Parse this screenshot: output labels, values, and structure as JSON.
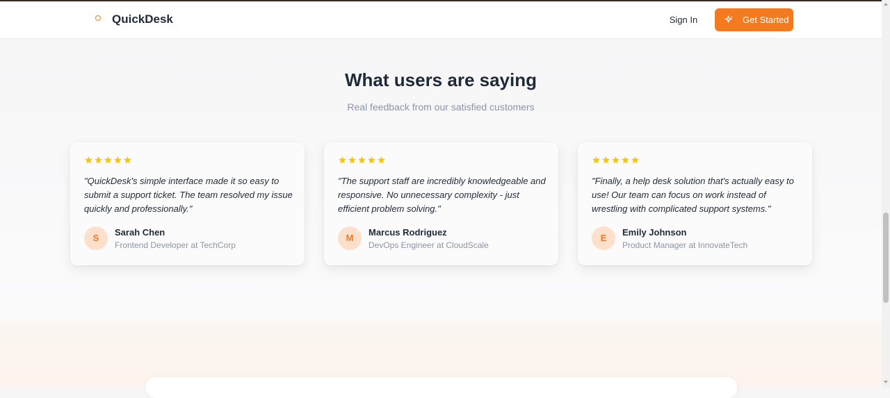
{
  "header": {
    "brand": "QuickDesk",
    "signin_label": "Sign In",
    "cta_label": "Get Started",
    "cta_icon": "sparkles-icon",
    "accent_color": "#f47a1f"
  },
  "testimonials": {
    "title": "What users are saying",
    "subtitle": "Real feedback from our satisfied customers",
    "star_color": "#f5c518",
    "cards": [
      {
        "rating": 5,
        "quote": "\"QuickDesk's simple interface made it so easy to submit a support ticket. The team resolved my issue quickly and professionally.\"",
        "initial": "S",
        "name": "Sarah Chen",
        "role": "Frontend Developer at TechCorp"
      },
      {
        "rating": 5,
        "quote": "\"The support staff are incredibly knowledgeable and responsive. No unnecessary complexity - just efficient problem solving.\"",
        "initial": "M",
        "name": "Marcus Rodriguez",
        "role": "DevOps Engineer at CloudScale"
      },
      {
        "rating": 5,
        "quote": "\"Finally, a help desk solution that's actually easy to use! Our team can focus on work instead of wrestling with complicated support systems.\"",
        "initial": "E",
        "name": "Emily Johnson",
        "role": "Product Manager at InnovateTech"
      }
    ]
  }
}
